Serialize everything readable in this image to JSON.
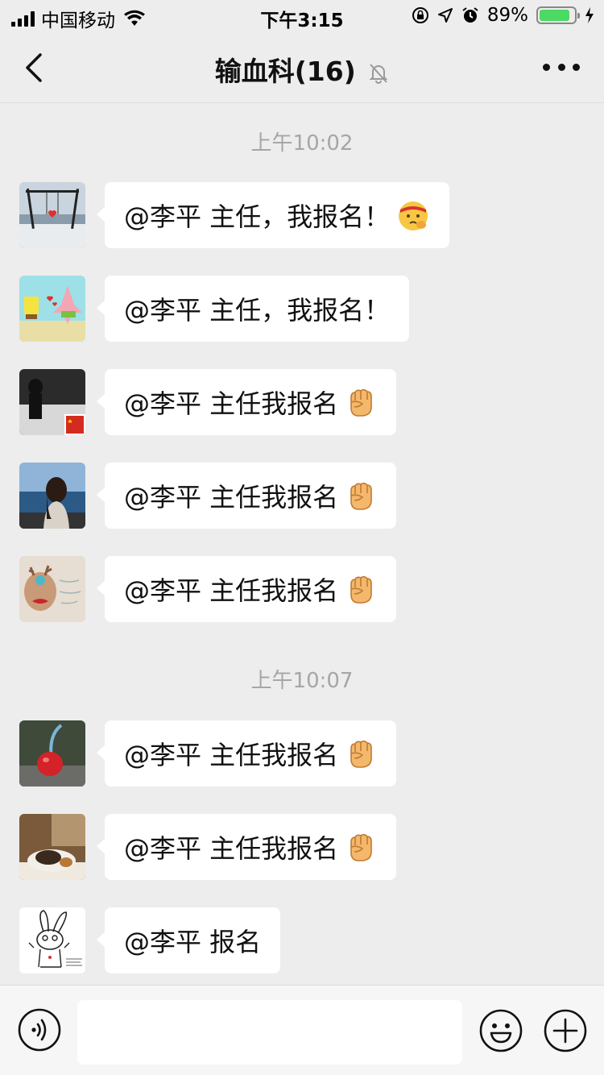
{
  "status_bar": {
    "carrier": "中国移动",
    "time": "下午3:15",
    "battery_percent": "89%",
    "battery_level": 0.89,
    "icons": [
      "signal-icon",
      "wifi-icon",
      "orientation-lock-icon",
      "location-icon",
      "alarm-icon",
      "battery-icon",
      "charging-icon"
    ]
  },
  "nav": {
    "title": "输血科(16)",
    "icons": [
      "back-icon",
      "mute-bell-icon",
      "more-icon"
    ]
  },
  "timestamps": [
    "上午10:02",
    "上午10:07"
  ],
  "messages": [
    {
      "text": "@李平 主任，我报名！",
      "emoji": "face-with-headband-icon",
      "avatar": "swing-beach-avatar"
    },
    {
      "text": "@李平 主任，我报名！",
      "emoji": "",
      "avatar": "spongebob-patrick-avatar"
    },
    {
      "text": "@李平 主任我报名",
      "emoji": "raised-fist-icon",
      "avatar": "snow-figure-avatar"
    },
    {
      "text": "@李平 主任我报名",
      "emoji": "raised-fist-icon",
      "avatar": "seaside-girl-avatar"
    },
    {
      "text": "@李平 主任我报名",
      "emoji": "raised-fist-icon",
      "avatar": "deer-antler-avatar"
    },
    {
      "text": "@李平 主任我报名",
      "emoji": "raised-fist-icon",
      "avatar": "cherry-sculpture-avatar"
    },
    {
      "text": "@李平 主任我报名",
      "emoji": "raised-fist-icon",
      "avatar": "cat-avatar"
    },
    {
      "text": "@李平 报名",
      "emoji": "",
      "avatar": "cartoon-rabbit-avatar"
    }
  ],
  "input_bar": {
    "value": "",
    "icons": [
      "voice-icon",
      "emoji-icon",
      "plus-icon"
    ]
  },
  "colors": {
    "background": "#ededed",
    "bubble": "#ffffff",
    "timestamp": "#a6a6a6",
    "battery_fill": "#4cd964"
  }
}
